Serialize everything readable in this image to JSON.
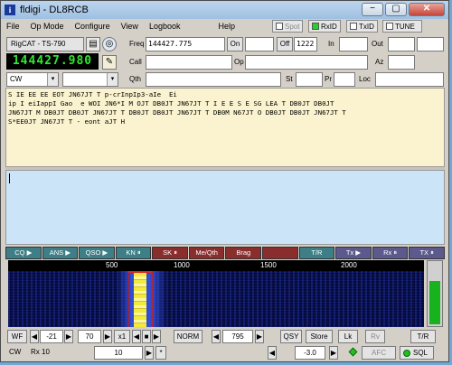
{
  "window": {
    "title": "fldigi - DL8RCB",
    "app_icon": "i",
    "minimize": "−",
    "maximize": "▢",
    "close": "✕"
  },
  "menu": {
    "items": [
      "File",
      "Op Mode",
      "Configure",
      "View",
      "Logbook",
      "Help"
    ],
    "spot": "Spot",
    "rxid": "RxID",
    "txid": "TxID",
    "tune": "TUNE"
  },
  "rig": {
    "name": "RigCAT - TS-790",
    "frequency_display": "144427.980",
    "mode": "CW",
    "mode_arrow": "▾",
    "bw_arrow": "▾"
  },
  "log": {
    "freq_label": "Freq",
    "freq_value": "144427.775",
    "on_label": "On",
    "on_value": "",
    "off_label": "Off",
    "off_value": "1222",
    "in_label": "In",
    "in_value": "",
    "out_label": "Out",
    "out_value": "",
    "call_label": "Call",
    "call_value": "",
    "op_label": "Op",
    "op_value": "",
    "az_label": "Az",
    "az_value": "",
    "qth_label": "Qth",
    "qth_value": "",
    "st_label": "St",
    "st_value": "",
    "pr_label": "Pr",
    "pr_value": "",
    "loc_label": "Loc",
    "loc_value": ""
  },
  "rx_text": [
    "S IE EE EE EOT JN67JT T p-crInpIp3-aIe  Ei",
    "ip I eiIappI Gao  e WOI JN6*I M OJT DB0JT JN67JT T I E E S E SG LEA T DB0JT DB0JT",
    "JN67JT M DB0JT DB0JT JN67JT T DB0JT DB0JT JN67JT T DB0M N67JT O DB0JT DB0JT JN67JT T",
    "S*EE0JT JN67JT T - eont aJT H"
  ],
  "macros": [
    {
      "label": "CQ ▶",
      "color": "teal"
    },
    {
      "label": "ANS ▶",
      "color": "teal"
    },
    {
      "label": "QSO ▶",
      "color": "teal"
    },
    {
      "label": "KN ⏸",
      "color": "teal"
    },
    {
      "label": "SK ⏸",
      "color": "red"
    },
    {
      "label": "Me/Qth",
      "color": "red"
    },
    {
      "label": "Brag",
      "color": "red"
    },
    {
      "label": "",
      "color": "red"
    },
    {
      "label": "T/R",
      "color": "teal"
    },
    {
      "label": "Tx ▶",
      "color": "purple"
    },
    {
      "label": "Rx ⏸",
      "color": "purple"
    },
    {
      "label": "TX ⏸",
      "color": "purple"
    }
  ],
  "scale_ticks": [
    "500",
    "1000",
    "1500",
    "2000"
  ],
  "controls": {
    "wf": "WF",
    "wf_arrow_left": "◀",
    "wf_value": "-21",
    "wf_arrow_right": "▶",
    "range_value": "70",
    "x1": "x1",
    "left": "◀",
    "stop": "■",
    "right": "▶",
    "norm": "NORM",
    "carrier_left": "◀",
    "carrier_value": "795",
    "carrier_right": "▶",
    "qsy": "QSY",
    "store": "Store",
    "lk": "Lk",
    "rv": "Rv",
    "tr": "T/R"
  },
  "status": {
    "mode": "CW",
    "rx_label": "Rx 10",
    "wpm_value": "10",
    "afc_value": "-3.0",
    "afc_label": "AFC",
    "sql_label": "SQL"
  },
  "signal_level": 0.7
}
